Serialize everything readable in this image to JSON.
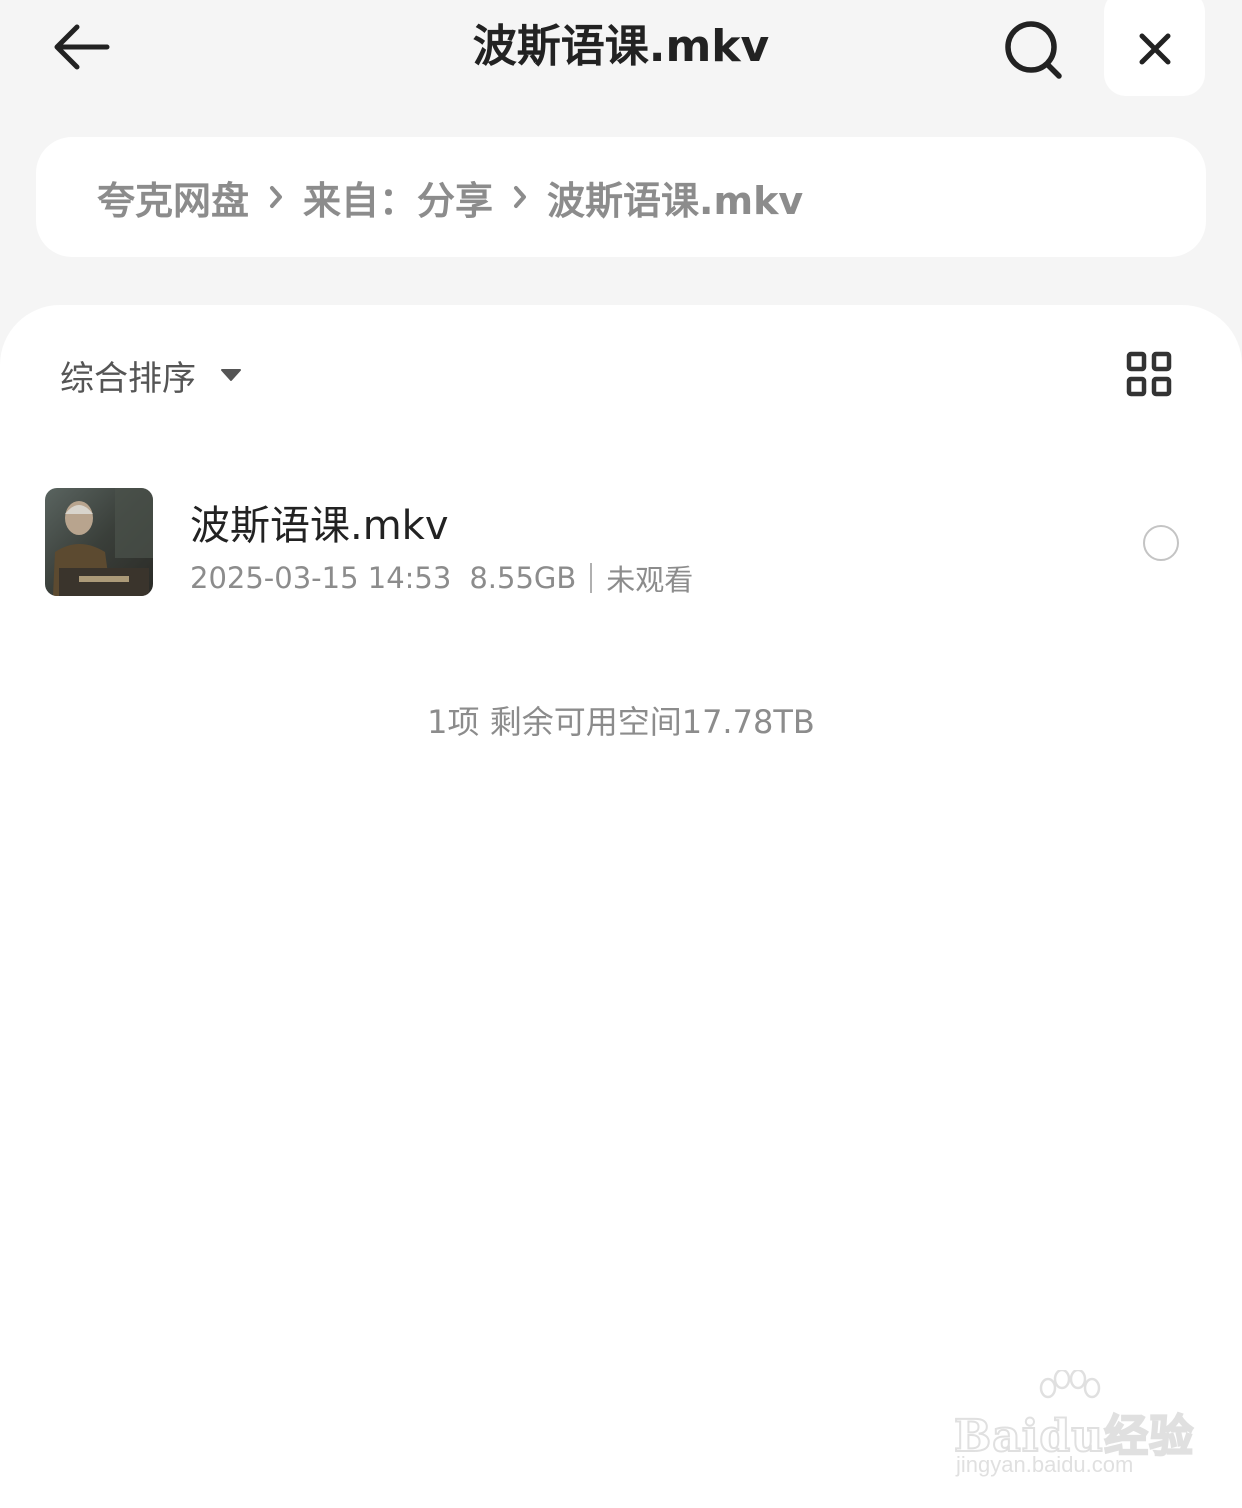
{
  "header": {
    "title": "波斯语课.mkv",
    "back_icon": "arrow-left-icon",
    "search_icon": "search-icon",
    "close_icon": "close-icon"
  },
  "breadcrumb": {
    "items": [
      "夸克网盘",
      "来自：分享",
      "波斯语课.mkv"
    ],
    "separator_icon": "chevron-right-icon"
  },
  "toolbar": {
    "sort_label": "综合排序",
    "sort_icon": "caret-down-icon",
    "view_toggle_icon": "grid-view-icon"
  },
  "files": [
    {
      "name": "波斯语课.mkv",
      "date": "2025-03-15 14:53",
      "size": "8.55GB",
      "status": "未观看",
      "thumbnail_icon": "video-thumbnail",
      "selected": false
    }
  ],
  "summary": "1项 剩余可用空间17.78TB",
  "watermark": {
    "brand": "Baidu经验",
    "url": "jingyan.baidu.com"
  },
  "colors": {
    "page_bg": "#f5f5f5",
    "card_bg": "#ffffff",
    "text_primary": "#222222",
    "text_secondary": "#8c8c8c"
  }
}
